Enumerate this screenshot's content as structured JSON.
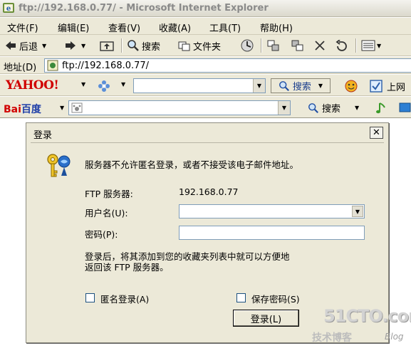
{
  "window": {
    "title": "ftp://192.168.0.77/ - Microsoft Internet Explorer"
  },
  "menu": {
    "items": [
      "文件(F)",
      "编辑(E)",
      "查看(V)",
      "收藏(A)",
      "工具(T)",
      "帮助(H)"
    ]
  },
  "toolbar": {
    "back_label": "后退",
    "search_label": "搜索",
    "folders_label": "文件夹"
  },
  "address": {
    "label": "地址(D)",
    "url": "ftp://192.168.0.77/"
  },
  "yahoo_bar": {
    "logo": "YAHOO!",
    "search_label": "搜索",
    "trailing_label": "上网"
  },
  "baidu_bar": {
    "logo_bai": "Bai",
    "logo_du": "百度",
    "search_label": "搜索"
  },
  "dialog": {
    "title": "登录",
    "close_glyph": "✕",
    "message": "服务器不允许匿名登录，或者不接受该电子邮件地址。",
    "server_label": "FTP 服务器:",
    "server_value": "192.168.0.77",
    "username_label": "用户名(U):",
    "username_value": "",
    "password_label": "密码(P):",
    "password_value": "",
    "info_line1": "登录后，将其添加到您的收藏夹列表中就可以方便地",
    "info_line2": "返回该 FTP 服务器。",
    "anonymous_label": "匿名登录(A)",
    "anonymous_checked": false,
    "save_password_label": "保存密码(S)",
    "save_password_checked": false,
    "login_button": "登录(L)"
  },
  "watermark": {
    "site": "51CTO.com",
    "sub": "技术博客",
    "blog": "Blog"
  }
}
